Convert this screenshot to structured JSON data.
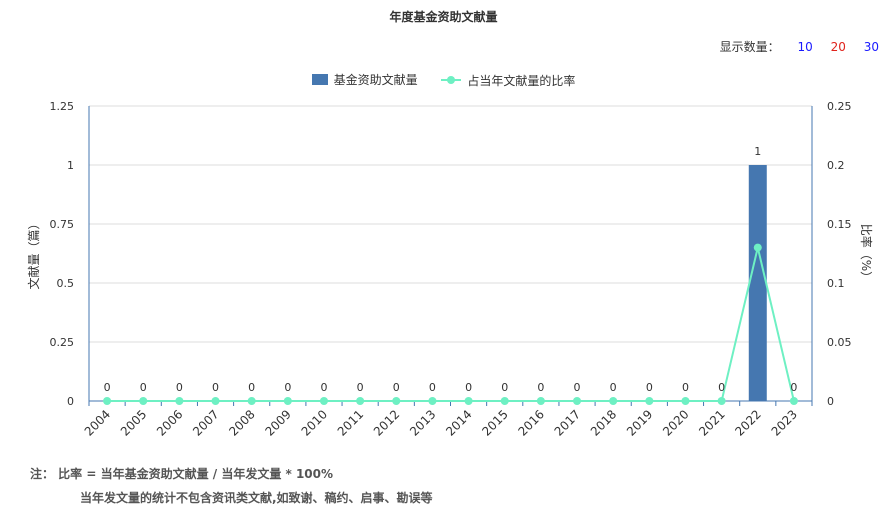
{
  "display_count": {
    "label": "显示数量：",
    "options": [
      {
        "label": "10",
        "color": "#1a1aff"
      },
      {
        "label": "20",
        "color": "#e0231c"
      },
      {
        "label": "30",
        "color": "#1a1aff"
      }
    ]
  },
  "notes": {
    "line1": "注： 比率 = 当年基金资助文献量 / 当年发文量 * 100%",
    "line2": "当年发文量的统计不包含资讯类文献,如致谢、稿约、启事、勘误等"
  },
  "chart_data": {
    "type": "bar",
    "title": "年度基金资助文献量",
    "categories": [
      "2004",
      "2005",
      "2006",
      "2007",
      "2008",
      "2009",
      "2010",
      "2011",
      "2012",
      "2013",
      "2014",
      "2015",
      "2016",
      "2017",
      "2018",
      "2019",
      "2020",
      "2021",
      "2022",
      "2023"
    ],
    "series": [
      {
        "name": "基金资助文献量",
        "type": "bar",
        "axis": "left",
        "color": "#4577b0",
        "values": [
          0,
          0,
          0,
          0,
          0,
          0,
          0,
          0,
          0,
          0,
          0,
          0,
          0,
          0,
          0,
          0,
          0,
          0,
          1,
          0
        ]
      },
      {
        "name": "占当年文献量的比率",
        "type": "line",
        "axis": "right",
        "color": "#6ef0c3",
        "values": [
          0,
          0,
          0,
          0,
          0,
          0,
          0,
          0,
          0,
          0,
          0,
          0,
          0,
          0,
          0,
          0,
          0,
          0,
          0.13,
          0
        ]
      }
    ],
    "ylabel": "文献量（篇）",
    "ylabel_right": "比率（%）",
    "ylim": [
      0,
      1.25
    ],
    "ylim_right": [
      0,
      0.25
    ],
    "yticks": [
      "0",
      "0.25",
      "0.5",
      "0.75",
      "1",
      "1.25"
    ],
    "yticks_right": [
      "0",
      "0.05",
      "0.1",
      "0.15",
      "0.2",
      "0.25"
    ],
    "data_labels": [
      "0",
      "0",
      "0",
      "0",
      "0",
      "0",
      "0",
      "0",
      "0",
      "0",
      "0",
      "0",
      "0",
      "0",
      "0",
      "0",
      "0",
      "0",
      "1",
      "0"
    ],
    "grid": true,
    "legend": "top-center"
  }
}
